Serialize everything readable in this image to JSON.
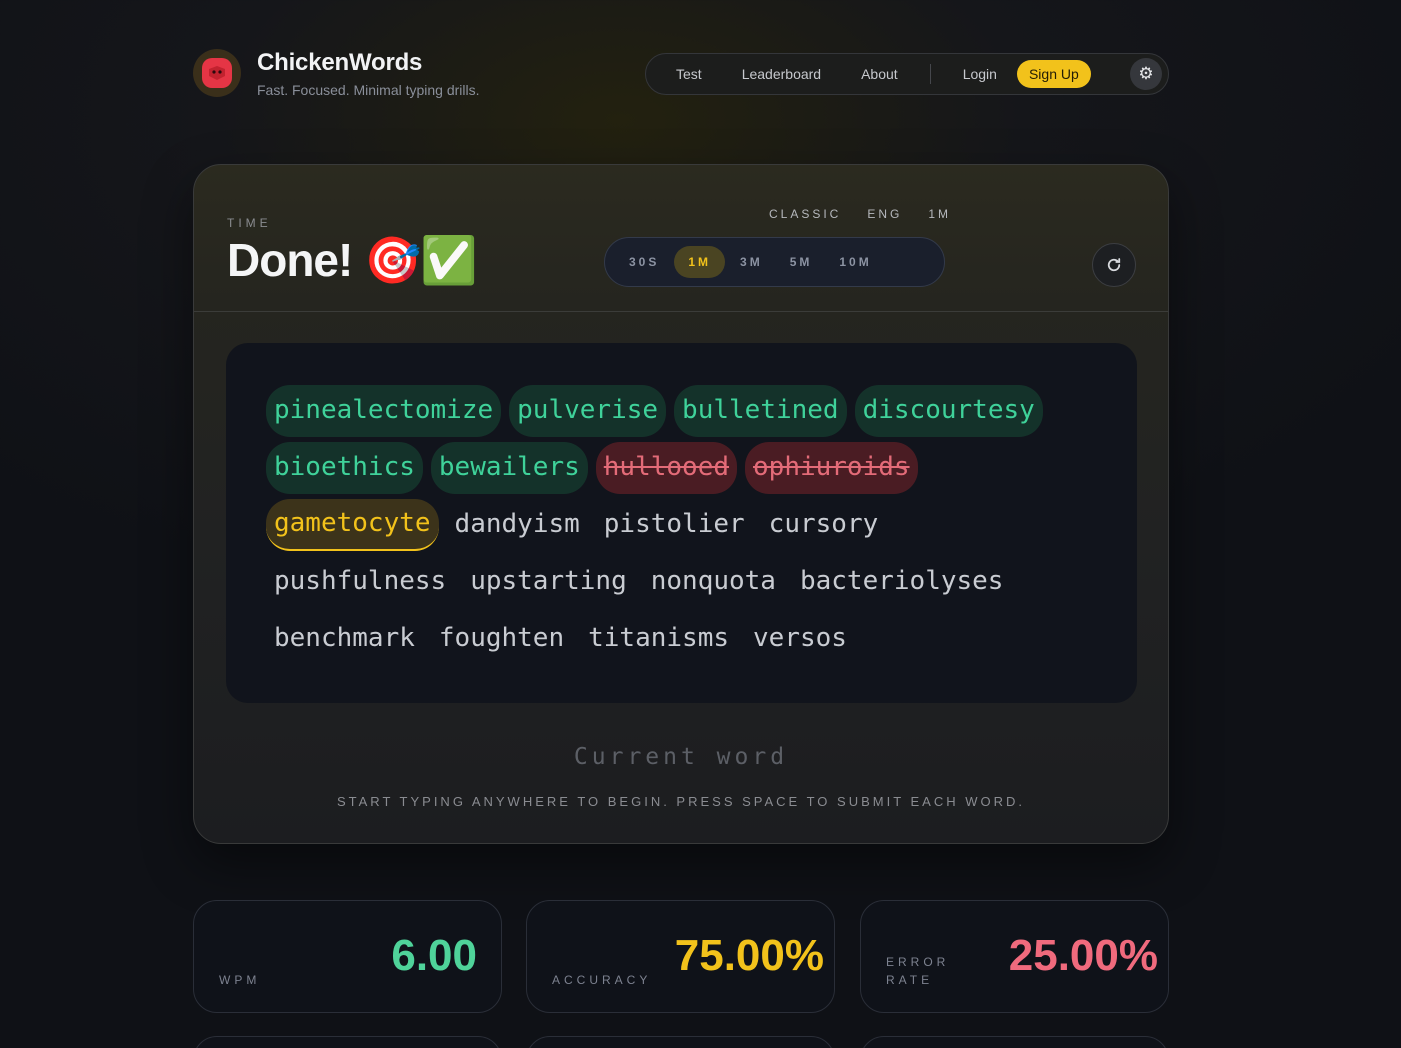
{
  "app": {
    "title": "ChickenWords",
    "subtitle": "Fast. Focused. Minimal typing drills."
  },
  "nav": {
    "links": [
      "Test",
      "Leaderboard",
      "About"
    ],
    "login": "Login",
    "signup": "Sign Up"
  },
  "test": {
    "time_label": "TIME",
    "time_value": "Done! 🎯✅",
    "meta": [
      "CLASSIC",
      "ENG",
      "1M"
    ],
    "durations": [
      "30S",
      "1M",
      "3M",
      "5M",
      "10M"
    ],
    "active_duration": "1M"
  },
  "words": [
    [
      {
        "text": "pinealectomize",
        "state": "correct"
      },
      {
        "text": "pulverise",
        "state": "correct"
      },
      {
        "text": "bulletined",
        "state": "correct"
      },
      {
        "text": "discourtesy",
        "state": "correct"
      }
    ],
    [
      {
        "text": "bioethics",
        "state": "correct"
      },
      {
        "text": "bewailers",
        "state": "correct"
      },
      {
        "text": "hullooed",
        "state": "wrong"
      },
      {
        "text": "ophiuroids",
        "state": "wrong"
      }
    ],
    [
      {
        "text": "gametocyte",
        "state": "current"
      },
      {
        "text": "dandyism",
        "state": "plain"
      },
      {
        "text": "pistolier",
        "state": "plain"
      },
      {
        "text": "cursory",
        "state": "plain"
      }
    ],
    [
      {
        "text": "pushfulness",
        "state": "plain"
      },
      {
        "text": "upstarting",
        "state": "plain"
      },
      {
        "text": "nonquota",
        "state": "plain"
      },
      {
        "text": "bacteriolyses",
        "state": "plain"
      }
    ],
    [
      {
        "text": "benchmark",
        "state": "plain"
      },
      {
        "text": "foughten",
        "state": "plain"
      },
      {
        "text": "titanisms",
        "state": "plain"
      },
      {
        "text": "versos",
        "state": "plain"
      }
    ]
  ],
  "input": {
    "placeholder": "Current word"
  },
  "hint": "START TYPING ANYWHERE TO BEGIN. PRESS SPACE TO SUBMIT EACH WORD.",
  "stats": {
    "wpm": {
      "label": "WPM",
      "value": "6.00"
    },
    "accuracy": {
      "label": "ACCURACY",
      "value": "75.00%"
    },
    "error_rate": {
      "label_line1": "ERROR",
      "label_line2": "RATE",
      "value": "25.00%"
    }
  },
  "colors": {
    "accent": "#f2c21b",
    "correct": "#3fd29a",
    "wrong": "#e36b78",
    "wpm": "#4fd39a",
    "accuracy": "#f2c21b",
    "error": "#f06a7d"
  }
}
